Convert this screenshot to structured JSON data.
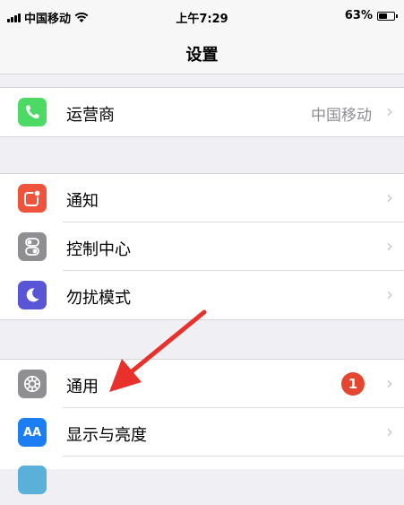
{
  "status_bar": {
    "carrier": "中国移动",
    "time": "上午7:29",
    "battery_percent": "63%",
    "battery_level": 0.63
  },
  "nav": {
    "title": "设置"
  },
  "rows": {
    "carrier": {
      "label": "运营商",
      "value": "中国移动",
      "icon": "phone-icon",
      "color": "#4cd964"
    },
    "notifications": {
      "label": "通知",
      "icon": "notifications-icon",
      "color": "#f0533c"
    },
    "control_center": {
      "label": "控制中心",
      "icon": "control-center-icon",
      "color": "#8e8e93"
    },
    "do_not_disturb": {
      "label": "勿扰模式",
      "icon": "moon-icon",
      "color": "#5856d6"
    },
    "general": {
      "label": "通用",
      "badge": "1",
      "icon": "gear-icon",
      "color": "#8e8e93"
    },
    "display": {
      "label": "显示与亮度",
      "icon": "display-icon",
      "color": "#1d7df2"
    }
  },
  "display_icon_text": "AA",
  "annotation": {
    "type": "red-arrow",
    "color": "#e8312a"
  }
}
